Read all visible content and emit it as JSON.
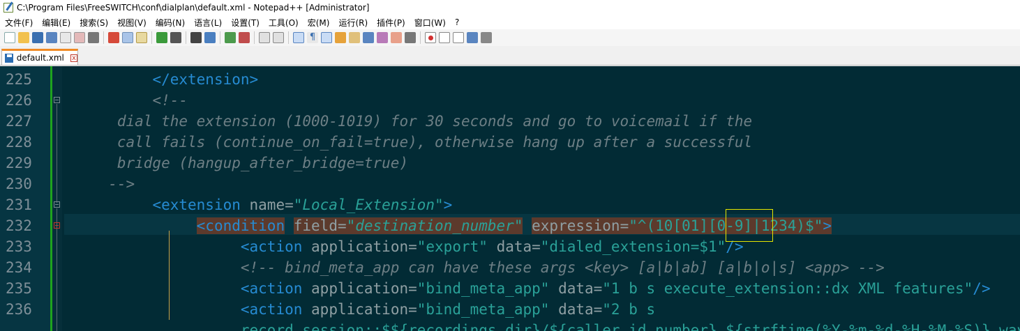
{
  "window": {
    "title": "C:\\Program Files\\FreeSWITCH\\conf\\dialplan\\default.xml - Notepad++ [Administrator]"
  },
  "menu": [
    "文件(F)",
    "编辑(E)",
    "搜索(S)",
    "视图(V)",
    "编码(N)",
    "语言(L)",
    "设置(T)",
    "工具(O)",
    "宏(M)",
    "运行(R)",
    "插件(P)",
    "窗口(W)",
    "?"
  ],
  "tab": {
    "label": "default.xml",
    "close": "x"
  },
  "lines": [
    {
      "num": "225",
      "parts": [
        {
          "t": "          "
        },
        {
          "c": "tag",
          "t": "</extension>"
        }
      ]
    },
    {
      "num": "226",
      "parts": [
        {
          "t": "          "
        },
        {
          "c": "cmt",
          "t": "<!--"
        }
      ]
    },
    {
      "num": "227",
      "parts": [
        {
          "t": "      "
        },
        {
          "c": "cmt",
          "t": "dial the extension (1000-1019) for 30 seconds and go to voicemail if the"
        }
      ]
    },
    {
      "num": "228",
      "parts": [
        {
          "t": "      "
        },
        {
          "c": "cmt",
          "t": "call fails (continue_on_fail=true), otherwise hang up after a successful"
        }
      ]
    },
    {
      "num": "229",
      "parts": [
        {
          "t": "      "
        },
        {
          "c": "cmt",
          "t": "bridge (hangup_after_bridge=true)"
        }
      ]
    },
    {
      "num": "230",
      "parts": [
        {
          "t": "     "
        },
        {
          "c": "cmt",
          "t": "-->"
        }
      ]
    },
    {
      "num": "231",
      "parts": [
        {
          "t": "          "
        },
        {
          "c": "tag",
          "t": "<extension "
        },
        {
          "c": "attr",
          "t": "name="
        },
        {
          "c": "str",
          "t": "\"Local_Extension\""
        },
        {
          "c": "tag",
          "t": ">"
        }
      ]
    },
    {
      "num": "232",
      "parts": [
        {
          "t": "               "
        },
        {
          "c": "tag hl",
          "t": "<condition"
        },
        {
          "t": " "
        },
        {
          "c": "attr hl",
          "t": "field="
        },
        {
          "c": "str hl",
          "t": "\"destination_number\""
        },
        {
          "t": " "
        },
        {
          "c": "attr hl",
          "t": "expression="
        },
        {
          "c": "strn hl",
          "t": "\"^(10[01][0-9]|1234)$\""
        },
        {
          "c": "tag hl",
          "t": ">"
        }
      ]
    },
    {
      "num": "233",
      "parts": [
        {
          "t": "                    "
        },
        {
          "c": "tag",
          "t": "<action "
        },
        {
          "c": "attr",
          "t": "application="
        },
        {
          "c": "strn",
          "t": "\"export\""
        },
        {
          "t": " "
        },
        {
          "c": "attr",
          "t": "data="
        },
        {
          "c": "strn",
          "t": "\"dialed_extension=$1\""
        },
        {
          "c": "tag",
          "t": "/>"
        }
      ]
    },
    {
      "num": "234",
      "parts": [
        {
          "t": "                    "
        },
        {
          "c": "cmt",
          "t": "<!-- bind_meta_app can have these args <key> [a|b|ab] [a|b|o|s] <app> -->"
        }
      ]
    },
    {
      "num": "235",
      "parts": [
        {
          "t": "                    "
        },
        {
          "c": "tag",
          "t": "<action "
        },
        {
          "c": "attr",
          "t": "application="
        },
        {
          "c": "strn",
          "t": "\"bind_meta_app\""
        },
        {
          "t": " "
        },
        {
          "c": "attr",
          "t": "data="
        },
        {
          "c": "strn",
          "t": "\"1 b s execute_extension::dx XML features\""
        },
        {
          "c": "tag",
          "t": "/>"
        }
      ]
    },
    {
      "num": "236",
      "parts": [
        {
          "t": "                    "
        },
        {
          "c": "tag",
          "t": "<action "
        },
        {
          "c": "attr",
          "t": "application="
        },
        {
          "c": "strn",
          "t": "\"bind_meta_app\""
        },
        {
          "t": " "
        },
        {
          "c": "attr",
          "t": "data="
        },
        {
          "c": "strn",
          "t": "\"2 b s"
        }
      ]
    },
    {
      "num": "",
      "parts": [
        {
          "t": "                    "
        },
        {
          "c": "strn",
          "t": "record_session::$${recordings_dir}/${caller_id_number}.${strftime(%Y-%m-%d-%H-%M-%S)}.wav\""
        },
        {
          "c": "tag",
          "t": "/>"
        }
      ]
    }
  ]
}
